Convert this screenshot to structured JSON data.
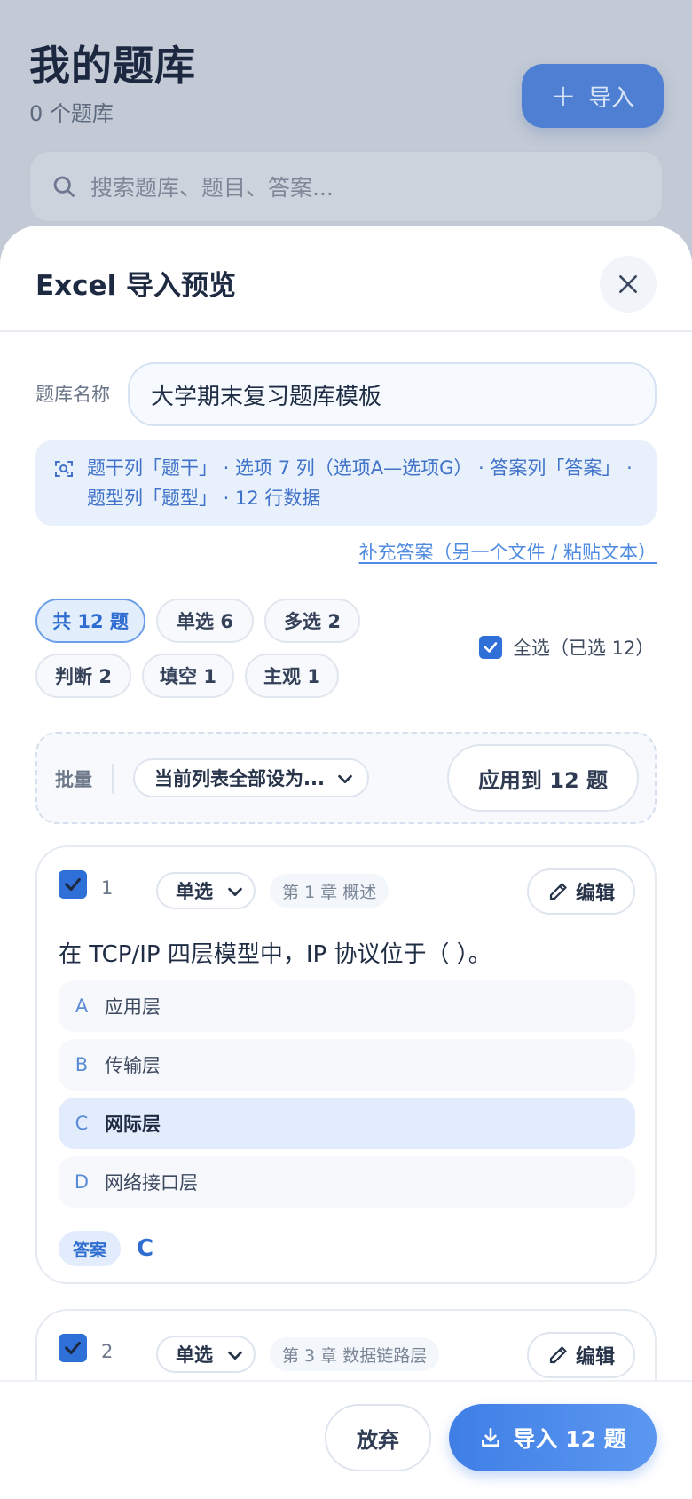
{
  "background": {
    "title": "我的题库",
    "subtitle": "0 个题库",
    "import_label": "导入",
    "search_placeholder": "搜索题库、题目、答案..."
  },
  "sheet": {
    "title": "Excel 导入预览",
    "name_label": "题库名称",
    "name_value": "大学期末复习题库模板",
    "detect_info": "题干列「题干」 · 选项 7 列（选项A—选项G） · 答案列「答案」 · 题型列「题型」 · 12 行数据",
    "supplement_link": "补充答案（另一个文件 / 粘贴文本）",
    "filters": [
      {
        "label": "共 12 题",
        "active": true
      },
      {
        "label": "单选 6",
        "active": false
      },
      {
        "label": "多选 2",
        "active": false
      },
      {
        "label": "判断 2",
        "active": false
      },
      {
        "label": "填空 1",
        "active": false
      },
      {
        "label": "主观 1",
        "active": false
      }
    ],
    "select_all_label": "全选（已选 12）",
    "batch": {
      "label": "批量",
      "select_value": "当前列表全部设为...",
      "apply_label": "应用到 12 题"
    },
    "questions": [
      {
        "num": "1",
        "type": "单选",
        "chapter": "第 1 章 概述",
        "edit_label": "编辑",
        "text": "在 TCP/IP 四层模型中，IP 协议位于（ ）。",
        "options": [
          {
            "letter": "A",
            "text": "应用层"
          },
          {
            "letter": "B",
            "text": "传输层"
          },
          {
            "letter": "C",
            "text": "网际层"
          },
          {
            "letter": "D",
            "text": "网络接口层"
          }
        ],
        "answer_label": "答案",
        "answer": "C"
      },
      {
        "num": "2",
        "type": "单选",
        "chapter": "第 3 章 数据链路层",
        "edit_label": "编辑"
      }
    ],
    "footer": {
      "discard_label": "放弃",
      "import_label": "导入 12 题"
    }
  },
  "colors": {
    "accent": "#2f6dd0",
    "checkbox": "#2e6fd8",
    "correct_option_bg": "#e2ecfc"
  }
}
